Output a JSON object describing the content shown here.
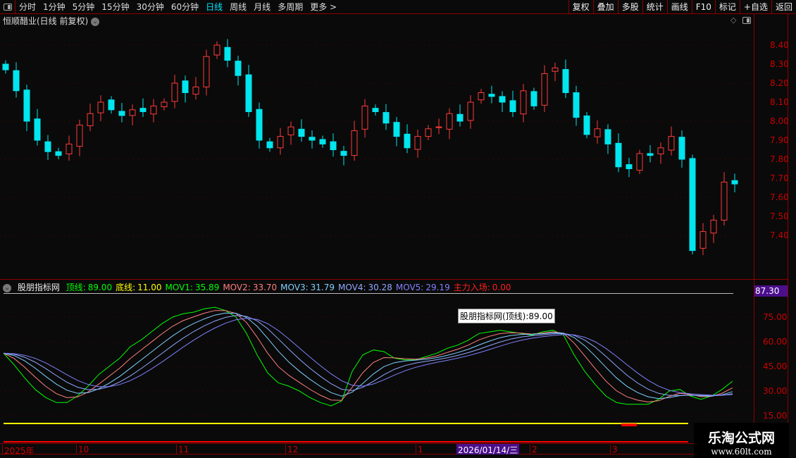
{
  "toolbar": {
    "periods": [
      "分时",
      "1分钟",
      "5分钟",
      "15分钟",
      "30分钟",
      "60分钟",
      "日线",
      "周线",
      "月线",
      "多周期",
      "更多 >"
    ],
    "active": "日线",
    "right_buttons": [
      "复权",
      "叠加",
      "多股",
      "统计",
      "画线",
      "F10",
      "标记",
      "+自选",
      "返回"
    ]
  },
  "stock_title": "恒顺醋业(日线 前复权)",
  "price_axis": [
    "8.40",
    "8.30",
    "8.20",
    "8.10",
    "8.00",
    "7.90",
    "7.80",
    "7.70",
    "7.60",
    "7.50",
    "7.40"
  ],
  "colors": {
    "up": "#ff3b3b",
    "down": "#00e5ee",
    "mov1": "#00ff00",
    "mov2": "#ff7f7f",
    "mov3": "#7fd0ff",
    "mov4": "#8fa8ff",
    "mov5": "#8080ff"
  },
  "candles_close": [
    8.27,
    8.16,
    8.0,
    7.9,
    7.84,
    7.82,
    7.88,
    7.98,
    8.04,
    8.1,
    8.06,
    8.03,
    8.06,
    8.05,
    8.08,
    8.1,
    8.2,
    8.15,
    8.18,
    8.34,
    8.4,
    8.32,
    8.24,
    8.05,
    7.9,
    7.86,
    7.92,
    7.97,
    7.92,
    7.9,
    7.88,
    7.85,
    7.82,
    7.95,
    8.08,
    8.05,
    7.99,
    7.92,
    7.86,
    7.92,
    7.96,
    7.97,
    8.04,
    8.0,
    8.1,
    8.15,
    8.13,
    8.1,
    8.05,
    8.16,
    8.08,
    8.25,
    8.28,
    8.15,
    8.02,
    7.93,
    7.96,
    7.88,
    7.76,
    7.75,
    7.83,
    7.82,
    7.86,
    7.92,
    7.8,
    7.32,
    7.42,
    7.48,
    7.68,
    7.67
  ],
  "indicator": {
    "name": "股朋指标网",
    "legend": [
      {
        "label": "顶线:",
        "value": "89.00",
        "color": "#00ff00",
        "lc": "#00ff00"
      },
      {
        "label": "底线:",
        "value": "11.00",
        "color": "#ffff00",
        "lc": "#ffff00"
      },
      {
        "label": "MOV1:",
        "value": "35.89",
        "color": "#00ff00",
        "lc": "#00ff00"
      },
      {
        "label": "MOV2:",
        "value": "33.70",
        "color": "#ff7f7f",
        "lc": "#ff7f7f"
      },
      {
        "label": "MOV3:",
        "value": "31.79",
        "color": "#7fd0ff",
        "lc": "#7fd0ff"
      },
      {
        "label": "MOV4:",
        "value": "30.28",
        "color": "#8fa8ff",
        "lc": "#8fa8ff"
      },
      {
        "label": "MOV5:",
        "value": "29.19",
        "color": "#8080ff",
        "lc": "#8080ff"
      },
      {
        "label": "主力入场:",
        "value": "0.00",
        "color": "#ff2020",
        "lc": "#ff2020"
      }
    ],
    "axis": [
      "75.00",
      "60.00",
      "45.00",
      "30.00",
      "15.00"
    ],
    "current": "87.30",
    "tooltip": "股朋指标网(顶线):89.00",
    "mov1": [
      53,
      46,
      38,
      31,
      26,
      23,
      23,
      27,
      33,
      40,
      45,
      50,
      57,
      61,
      66,
      71,
      75,
      77,
      78,
      80,
      81,
      79,
      75,
      65,
      52,
      41,
      35,
      33,
      30,
      26,
      23,
      21,
      24,
      42,
      52,
      55,
      54,
      50,
      49,
      49,
      51,
      53,
      56,
      58,
      61,
      65,
      66,
      67,
      66,
      65,
      64,
      66,
      67,
      64,
      52,
      42,
      34,
      27,
      23,
      22,
      22,
      22,
      25,
      30,
      31,
      27,
      25,
      27,
      31,
      36
    ]
  },
  "xaxis": {
    "labels": [
      "2025年",
      "10",
      "11",
      "12",
      "1",
      "2",
      "3"
    ],
    "cursor_date": "2026/01/14/三"
  },
  "watermark": {
    "name": "乐淘公式网",
    "url": "www.60lt.com"
  }
}
